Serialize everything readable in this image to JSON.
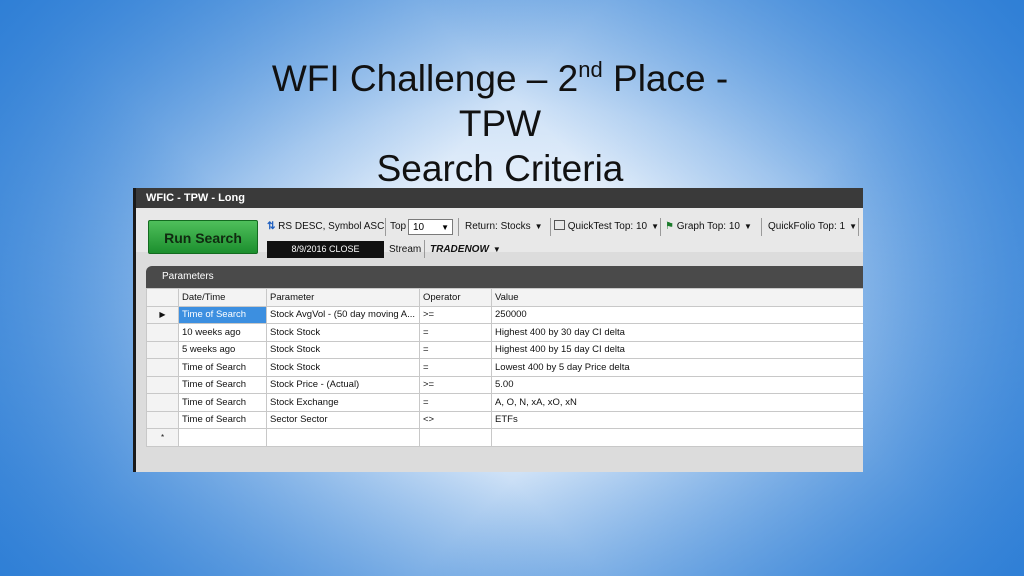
{
  "slide": {
    "title_line1_pre": "WFI Challenge – 2",
    "title_sup": "nd",
    "title_line1_post": " Place -",
    "title_line2": "TPW",
    "title_line3": "Search Criteria"
  },
  "window": {
    "title": "WFIC - TPW - Long",
    "run_button": "Run Search",
    "sort_label": "RS DESC, Symbol ASC",
    "top_label": "Top",
    "top_value": "10",
    "return_label": "Return: Stocks",
    "quicktest_label": "QuickTest Top: 10",
    "graph_label": "Graph Top: 10",
    "quickfolio_label": "QuickFolio Top: 1",
    "date_label": "8/9/2016  CLOSE",
    "stream_label": "Stream",
    "tradenow_label": "TRADENOW",
    "panel_title": "Parameters"
  },
  "table": {
    "headers": [
      "Date/Time",
      "Parameter",
      "Operator",
      "Value"
    ],
    "rows": [
      [
        "Time of Search",
        "Stock AvgVol - (50 day moving A...",
        ">=",
        "250000"
      ],
      [
        "10 weeks ago",
        "Stock Stock",
        "=",
        "Highest 400 by 30 day CI delta"
      ],
      [
        "5 weeks ago",
        "Stock Stock",
        "=",
        "Highest 400 by 15 day CI delta"
      ],
      [
        "Time of Search",
        "Stock Stock",
        "=",
        "Lowest 400 by 5 day Price delta"
      ],
      [
        "Time of Search",
        "Stock Price - (Actual)",
        ">=",
        "5.00"
      ],
      [
        "Time of Search",
        "Stock Exchange",
        "=",
        "A, O, N, xA, xO, xN"
      ],
      [
        "Time of Search",
        "Sector Sector",
        "<>",
        "ETFs"
      ]
    ],
    "current_row_marker": "▶",
    "new_row_marker": "*"
  }
}
